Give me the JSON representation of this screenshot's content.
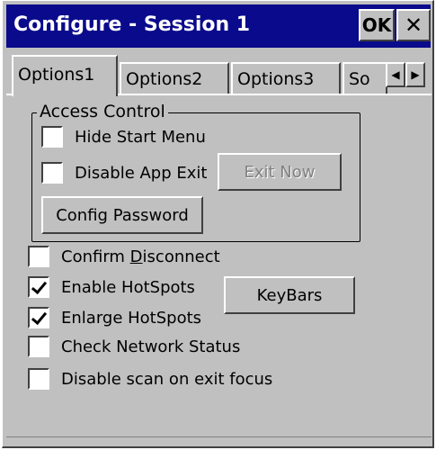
{
  "window": {
    "title": "Configure - Session 1",
    "ok_label": "OK",
    "close_label": "✕"
  },
  "tabs": [
    {
      "label": "Options1",
      "active": true
    },
    {
      "label": "Options2",
      "active": false
    },
    {
      "label": "Options3",
      "active": false
    },
    {
      "label": "So",
      "active": false
    }
  ],
  "tab_scroll": {
    "left": "◀",
    "right": "▶"
  },
  "access_control": {
    "group_label": "Access Control",
    "hide_start_menu": {
      "label": "Hide Start Menu",
      "checked": false
    },
    "disable_app_exit": {
      "label": "Disable App Exit",
      "checked": false
    },
    "exit_now_label": "Exit Now",
    "config_password_label": "Config Password"
  },
  "options": {
    "confirm_disconnect": {
      "label_pre": "Confirm ",
      "label_underlined": "D",
      "label_post": "isconnect",
      "checked": false
    },
    "enable_hotspots": {
      "label": "Enable HotSpots",
      "checked": true
    },
    "enlarge_hotspots": {
      "label": "Enlarge HotSpots",
      "checked": true
    },
    "check_network_status": {
      "label": "Check Network Status",
      "checked": false
    },
    "disable_scan": {
      "label": "Disable scan on exit focus",
      "checked": false
    },
    "keybars_label": "KeyBars"
  }
}
